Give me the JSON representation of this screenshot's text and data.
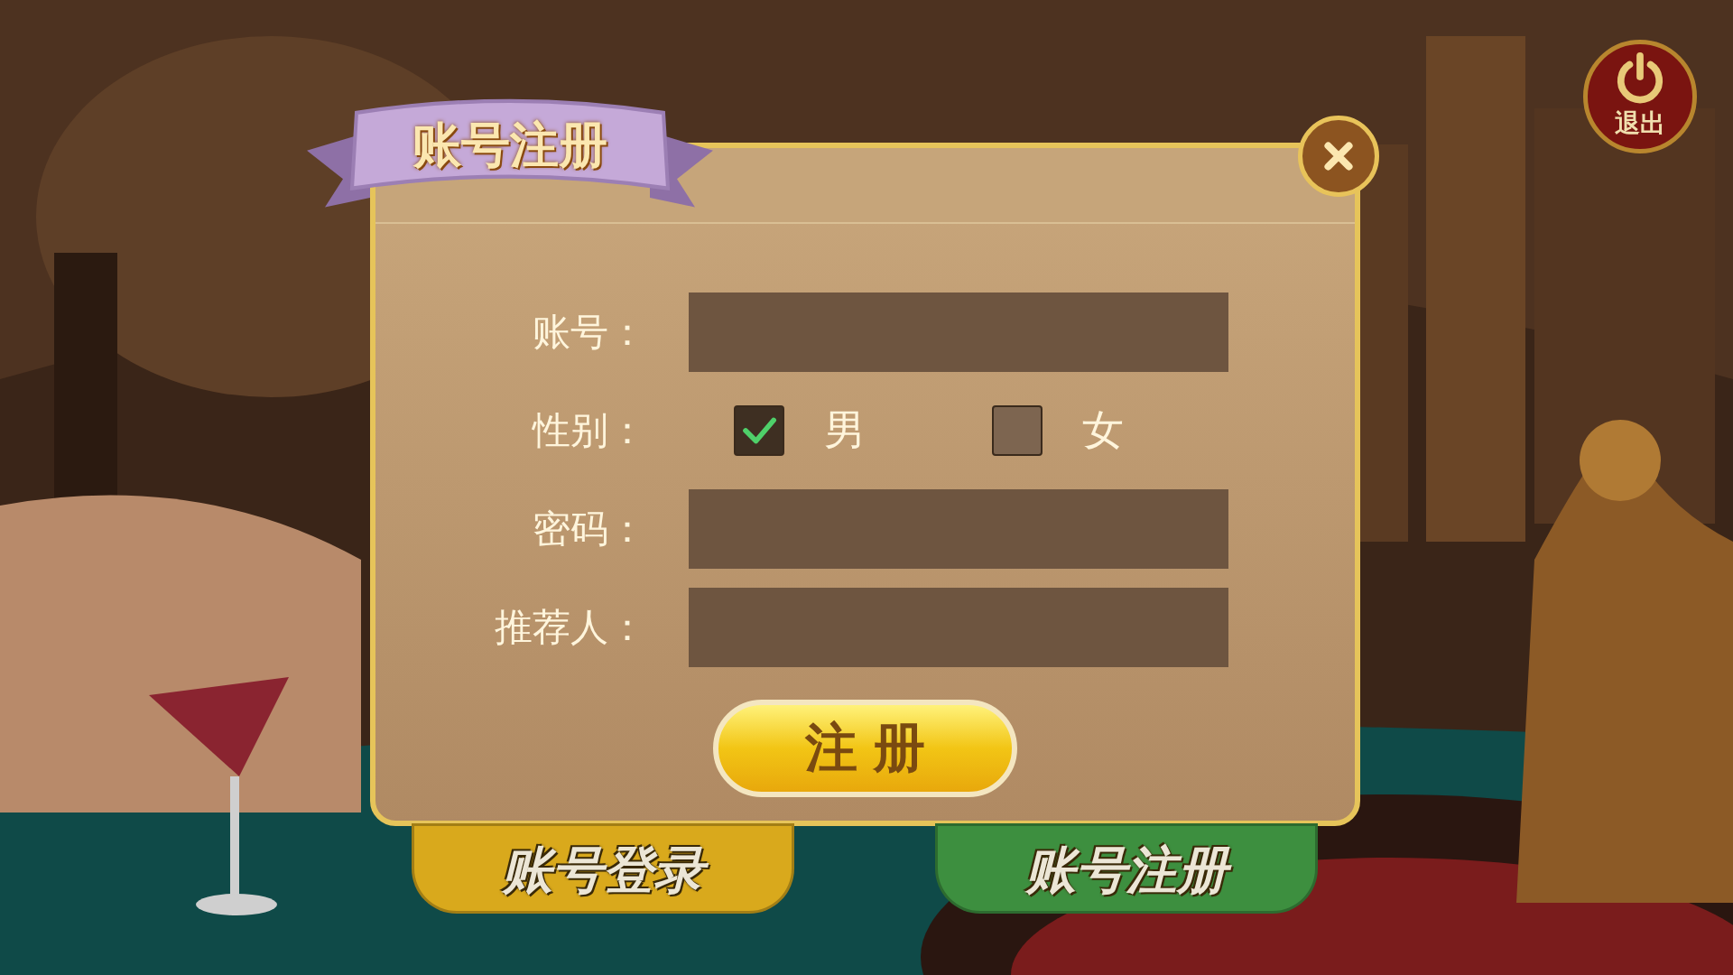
{
  "exit_button": {
    "label": "退出"
  },
  "dialog": {
    "title": "账号注册",
    "rows": [
      {
        "kind": "input",
        "label": "账号："
      },
      {
        "kind": "choice",
        "label": "性别：",
        "options": [
          {
            "label": "男",
            "checked": true
          },
          {
            "label": "女",
            "checked": false
          }
        ]
      },
      {
        "kind": "input",
        "label": "密码："
      },
      {
        "kind": "input",
        "label": "推荐人："
      }
    ],
    "submit": "注 册"
  },
  "bottom_buttons": [
    {
      "label": "账号登录",
      "color": "#d9a91c"
    },
    {
      "label": "账号注册",
      "color": "#3d8f3f"
    }
  ]
}
